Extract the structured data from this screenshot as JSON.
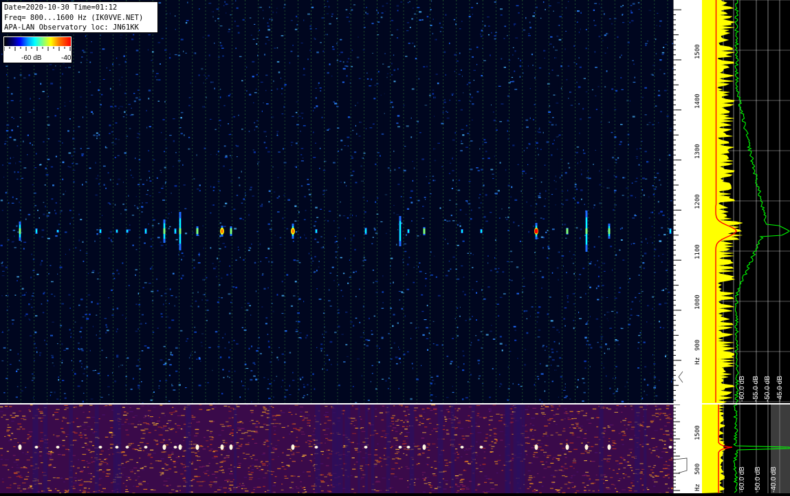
{
  "info": {
    "line1": "Date=2020-10-30 Time=01:12",
    "line2": "Freq= 800...1600 Hz (IK0VVE.NET)",
    "line3": "APA-LAN Observatory loc: JN61KK"
  },
  "colorbar": {
    "min_label": "-60 dB",
    "max_label": "-40"
  },
  "axis_main": {
    "unit": "Hz",
    "ticks": [
      {
        "freq": 1500,
        "label": "1500"
      },
      {
        "freq": 1400,
        "label": "1400"
      },
      {
        "freq": 1300,
        "label": "1300"
      },
      {
        "freq": 1200,
        "label": "1200"
      },
      {
        "freq": 1100,
        "label": "1100"
      },
      {
        "freq": 1000,
        "label": "1000"
      },
      {
        "freq": 900,
        "label": "900"
      }
    ]
  },
  "axis_lower": {
    "unit": "Hz",
    "ticks": [
      {
        "freq": 1500,
        "label": "1500"
      },
      {
        "freq": 500,
        "label": "500"
      }
    ]
  },
  "spectrum_main": {
    "db_labels": [
      "-60.0 dB",
      "-55.0 dB",
      "-50.0 dB",
      "-45.0 dB"
    ]
  },
  "spectrum_lower": {
    "db_labels": [
      "-60.0 dB",
      "-50.0 dB",
      "-40.0 dB"
    ]
  },
  "colors": {
    "background": "#000000",
    "waterfall_bg": "#00061f",
    "speckle": "#1e6bff",
    "grid": "#3a8f3a",
    "yellow_trace": "#ffff00",
    "red_trace": "#ff0000",
    "green_trace": "#00ff00",
    "lower_hot": "#f0a020"
  },
  "meteor_frequency_hz": 1158
}
